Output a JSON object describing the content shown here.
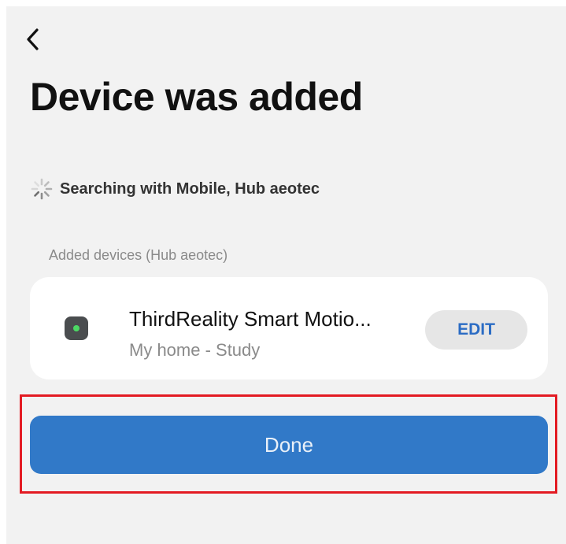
{
  "header": {
    "back_icon": "chevron-left-icon",
    "title": "Device was added"
  },
  "search_status": {
    "icon": "loading-spinner-icon",
    "text": "Searching with Mobile, Hub aeotec"
  },
  "added_devices": {
    "section_label": "Added devices (Hub aeotec)",
    "items": [
      {
        "icon": "device-sensor-icon",
        "name": "ThirdReality Smart Motio...",
        "location": "My home - Study",
        "edit_label": "EDIT"
      }
    ]
  },
  "actions": {
    "done_label": "Done"
  },
  "colors": {
    "accent": "#3179c8",
    "highlight": "#e31b23",
    "background": "#f2f2f2"
  }
}
